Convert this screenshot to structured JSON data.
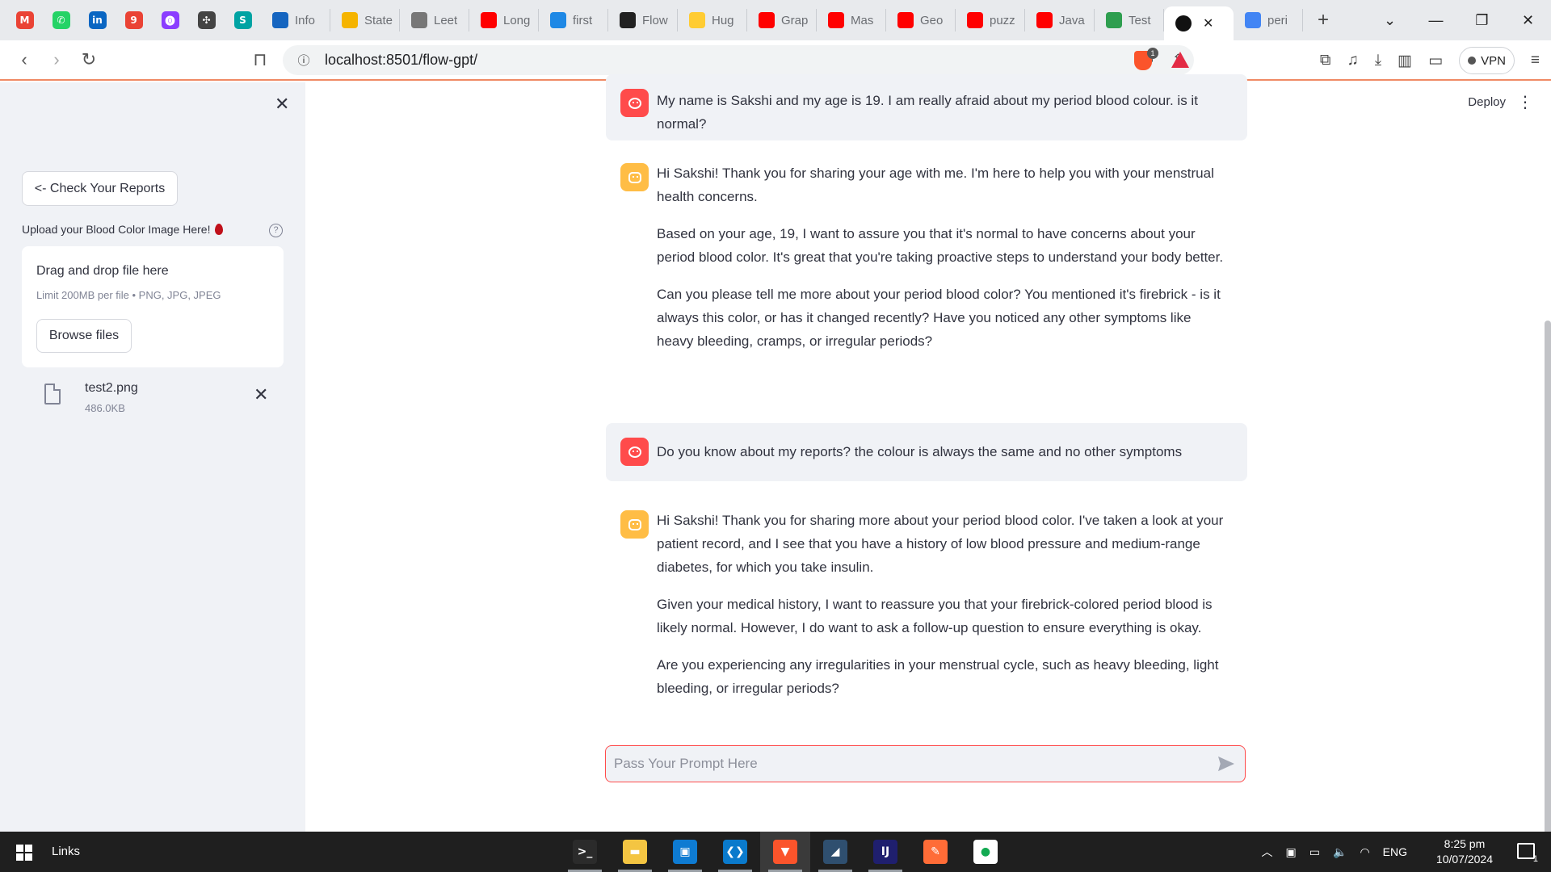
{
  "browser": {
    "pinned": [
      {
        "name": "gmail",
        "glyph": "M",
        "color": "#ea4335"
      },
      {
        "name": "whatsapp",
        "glyph": "✆",
        "color": "#25d366"
      },
      {
        "name": "linkedin",
        "glyph": "in",
        "color": "#0a66c2"
      },
      {
        "name": "app-9",
        "glyph": "9",
        "color": "#ea4335"
      },
      {
        "name": "app-purple",
        "glyph": "⓿",
        "color": "#8b3dff"
      },
      {
        "name": "chatgpt",
        "glyph": "✣",
        "color": "#444444"
      },
      {
        "name": "app-s",
        "glyph": "S",
        "color": "#00a3a3"
      }
    ],
    "tabs": [
      {
        "title": "Info",
        "color": "#1565c0"
      },
      {
        "title": "State",
        "color": "#f5b400"
      },
      {
        "title": "Leet",
        "color": "#777777"
      },
      {
        "title": "Long",
        "color": "#ff0000"
      },
      {
        "title": "first",
        "color": "#1e88e5"
      },
      {
        "title": "Flow",
        "color": "#222222"
      },
      {
        "title": "Hug",
        "color": "#ffcc33"
      },
      {
        "title": "Grap",
        "color": "#ff0000"
      },
      {
        "title": "Mas",
        "color": "#ff0000"
      },
      {
        "title": "Geo",
        "color": "#ff0000"
      },
      {
        "title": "puzz",
        "color": "#ff0000"
      },
      {
        "title": "Java",
        "color": "#ff0000"
      },
      {
        "title": "Test",
        "color": "#2e9e4f"
      },
      {
        "title": "",
        "color": "#111111"
      },
      {
        "title": "peri",
        "color": "#4285f4"
      }
    ],
    "new_tab_glyph": "+",
    "url": "localhost:8501/flow-gpt/",
    "brave_badge": "1",
    "vpn_label": "VPN"
  },
  "sidebar": {
    "close_glyph": "✕",
    "check_reports_label": "<- Check Your Reports",
    "upload_label": "Upload your Blood Color Image Here!",
    "help_glyph": "?",
    "dropzone_title": "Drag and drop file here",
    "dropzone_limit": "Limit 200MB per file • PNG, JPG, JPEG",
    "browse_label": "Browse files",
    "file": {
      "name": "test2.png",
      "size": "486.0KB"
    },
    "remove_glyph": "✕"
  },
  "header": {
    "deploy_label": "Deploy",
    "menu_glyph": "⋮"
  },
  "chat": {
    "messages": [
      {
        "role": "user",
        "paragraphs": [
          "My name is Sakshi and my age is 19. I am really afraid about my period blood colour. is it normal?"
        ]
      },
      {
        "role": "assistant",
        "paragraphs": [
          "Hi Sakshi! Thank you for sharing your age with me. I'm here to help you with your menstrual health concerns.",
          "Based on your age, 19, I want to assure you that it's normal to have concerns about your period blood color. It's great that you're taking proactive steps to understand your body better.",
          "Can you please tell me more about your period blood color? You mentioned it's firebrick - is it always this color, or has it changed recently? Have you noticed any other symptoms like heavy bleeding, cramps, or irregular periods?"
        ]
      },
      {
        "role": "user",
        "paragraphs": [
          "Do you know about my reports? the colour is always the same and no other symptoms"
        ]
      },
      {
        "role": "assistant",
        "paragraphs": [
          "Hi Sakshi! Thank you for sharing more about your period blood color. I've taken a look at your patient record, and I see that you have a history of low blood pressure and medium-range diabetes, for which you take insulin.",
          "Given your medical history, I want to reassure you that your firebrick-colored period blood is likely normal. However, I do want to ask a follow-up question to ensure everything is okay.",
          "Are you experiencing any irregularities in your menstrual cycle, such as heavy bleeding, light bleeding, or irregular periods?"
        ]
      }
    ],
    "input_placeholder": "Pass Your Prompt Here"
  },
  "taskbar": {
    "links_label": "Links",
    "apps": [
      {
        "name": "terminal",
        "glyph": ">_",
        "color": "#2b2b2b",
        "running": true
      },
      {
        "name": "file-explorer",
        "glyph": "▬",
        "color": "#f4c542",
        "running": true
      },
      {
        "name": "app-blue-square",
        "glyph": "▣",
        "color": "#0e7bd2",
        "running": true
      },
      {
        "name": "vscode",
        "glyph": "❮❯",
        "color": "#0a7acc",
        "running": true
      },
      {
        "name": "brave",
        "glyph": "▼",
        "color": "#fb542b",
        "running": true,
        "active": true
      },
      {
        "name": "mysql-workbench",
        "glyph": "◢",
        "color": "#2f4f6f",
        "running": true
      },
      {
        "name": "intellij",
        "glyph": "IJ",
        "color": "#1f1f6e",
        "running": true
      },
      {
        "name": "postman",
        "glyph": "✎",
        "color": "#ff6c37",
        "running": false
      },
      {
        "name": "mongodb-compass",
        "glyph": "●",
        "color": "#ffffff",
        "running": false
      }
    ],
    "tray": {
      "language": "ENG"
    },
    "time": "8:25 pm",
    "date": "10/07/2024",
    "notification_count": "1"
  }
}
